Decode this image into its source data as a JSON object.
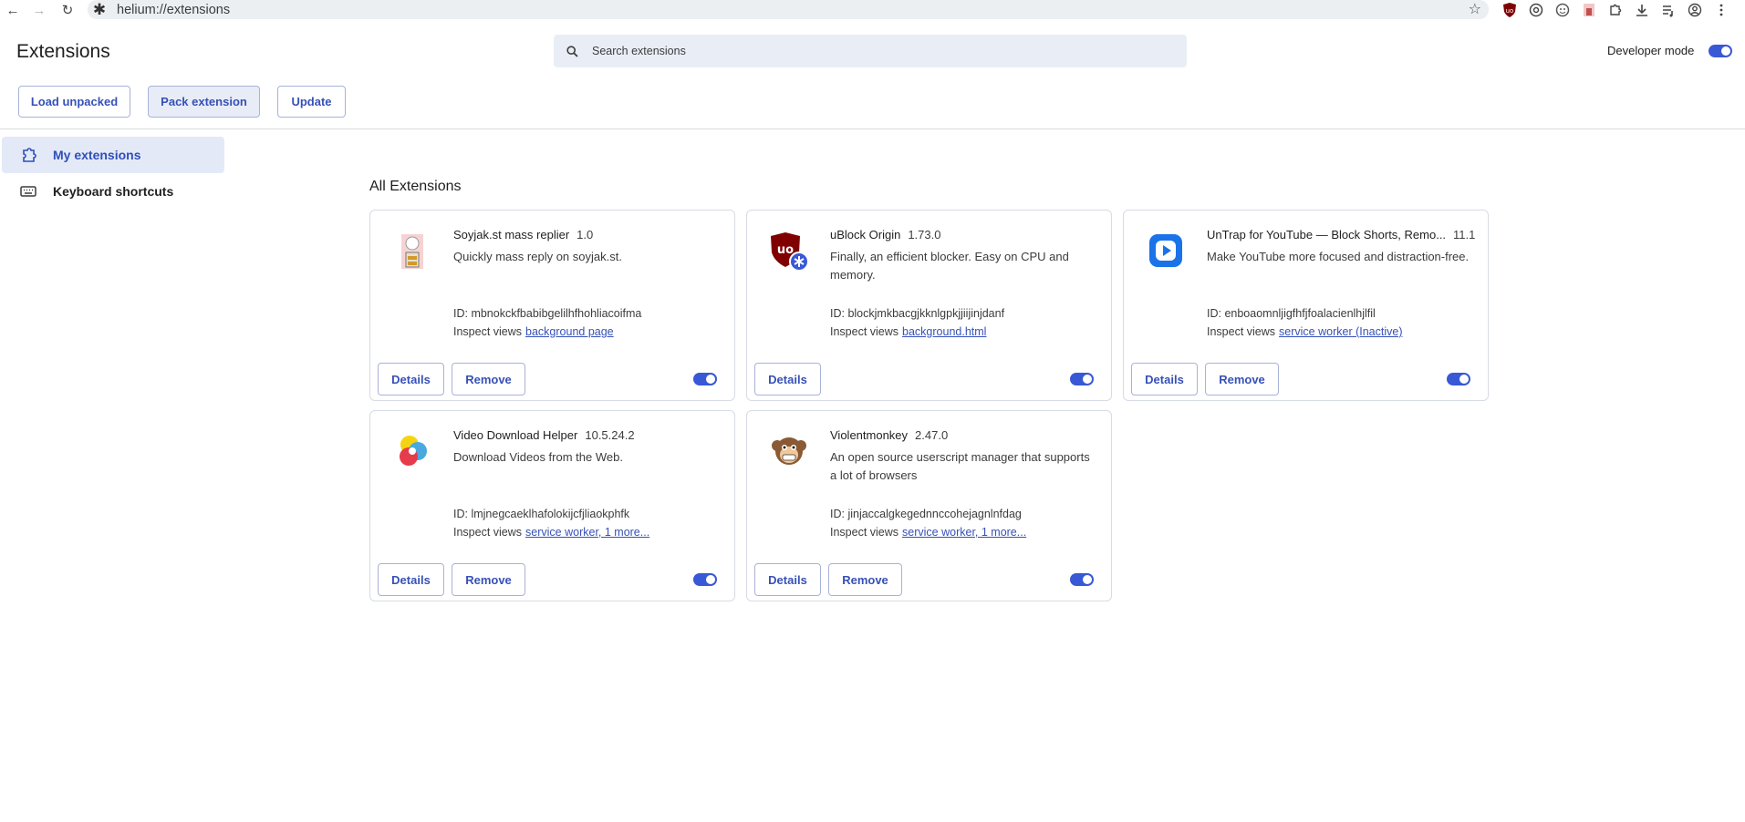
{
  "browser": {
    "url": "helium://extensions",
    "toolbar_icons": [
      "ublock-icon",
      "extension-puzzle-icon",
      "untrap-icon",
      "violentmonkey-icon",
      "soyjak-icon",
      "extensions-icon",
      "download-icon",
      "media-queue-icon",
      "profile-icon",
      "menu-icon"
    ]
  },
  "header": {
    "title": "Extensions",
    "search_placeholder": "Search extensions",
    "developer_mode_label": "Developer mode",
    "developer_mode_on": true,
    "buttons": {
      "load_unpacked": "Load unpacked",
      "pack_extension": "Pack extension",
      "update": "Update"
    }
  },
  "sidebar": {
    "items": [
      {
        "label": "My extensions",
        "icon": "extensions-icon",
        "selected": true
      },
      {
        "label": "Keyboard shortcuts",
        "icon": "keyboard-icon",
        "selected": false
      }
    ]
  },
  "main": {
    "section_title": "All Extensions",
    "details_label": "Details",
    "remove_label": "Remove",
    "inspect_label": "Inspect views",
    "extensions": [
      {
        "name": "Soyjak.st mass replier",
        "version": "1.0",
        "description": "Quickly mass reply on soyjak.st.",
        "id": "ID: mbnokckfbabibgelilhfhohliacoifma",
        "inspect_link": "background page",
        "enabled": true,
        "has_remove": true
      },
      {
        "name": "uBlock Origin",
        "version": "1.73.0",
        "description": "Finally, an efficient blocker. Easy on CPU and memory.",
        "id": "ID: blockjmkbacgjkknlgpkjjiijinjdanf",
        "inspect_link": "background.html",
        "enabled": true,
        "has_remove": false
      },
      {
        "name": "UnTrap for YouTube — Block Shorts, Remo...",
        "version": "11.1",
        "description": "Make YouTube more focused and distraction-free.",
        "id": "ID: enboaomnljigfhfjfoalacienlhjlfil",
        "inspect_link": "service worker (Inactive)",
        "enabled": true,
        "has_remove": true
      },
      {
        "name": "Video Download Helper",
        "version": "10.5.24.2",
        "description": "Download Videos from the Web.",
        "id": "ID: lmjnegcaeklhafolokijcfjliaokphfk",
        "inspect_link": "service worker, 1 more...",
        "enabled": true,
        "has_remove": true
      },
      {
        "name": "Violentmonkey",
        "version": "2.47.0",
        "description": "An open source userscript manager that supports a lot of browsers",
        "id": "ID: jinjaccalgkegednnccohejagnlnfdag",
        "inspect_link": "service worker, 1 more...",
        "enabled": true,
        "has_remove": true
      }
    ]
  }
}
